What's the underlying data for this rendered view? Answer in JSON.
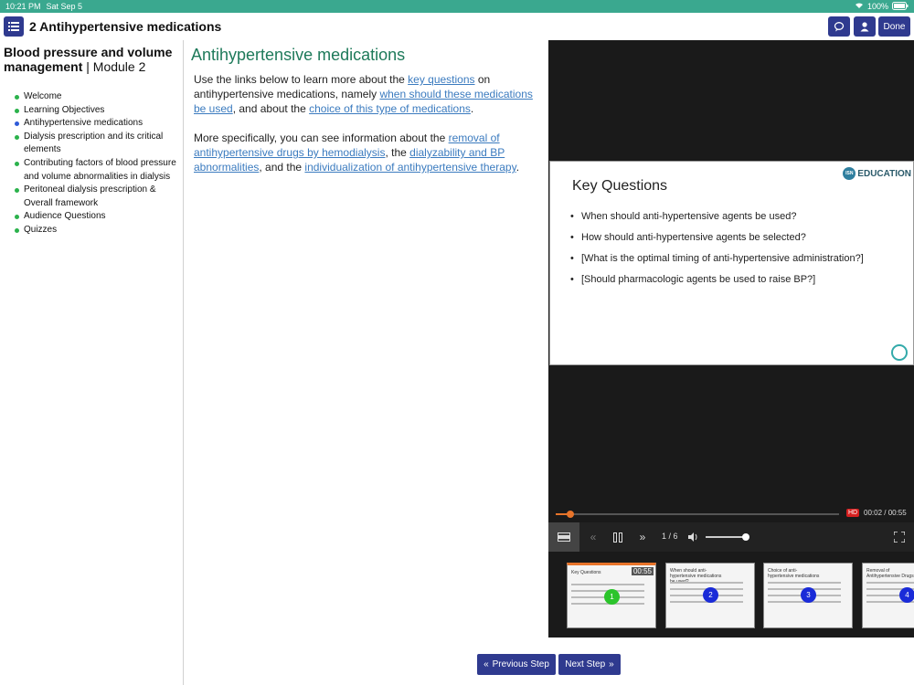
{
  "status": {
    "time": "10:21 PM",
    "date": "Sat Sep 5",
    "battery": "100%"
  },
  "header": {
    "title": "2 Antihypertensive medications",
    "done_label": "Done"
  },
  "sidebar": {
    "title_bold": "Blood pressure and volume management",
    "title_sep": " | ",
    "title_rest": "Module 2",
    "items": [
      {
        "label": "Welcome",
        "color": "#2bb24c"
      },
      {
        "label": "Learning Objectives",
        "color": "#2bb24c"
      },
      {
        "label": "Antihypertensive medications",
        "color": "#2f5bd8"
      },
      {
        "label": "Dialysis prescription and its critical elements",
        "color": "#2bb24c"
      },
      {
        "label": "Contributing factors of blood pressure and volume abnormalities in dialysis",
        "color": "#2bb24c"
      },
      {
        "label": "Peritoneal dialysis prescription & Overall framework",
        "color": "#2bb24c"
      },
      {
        "label": "Audience Questions",
        "color": "#2bb24c"
      },
      {
        "label": "Quizzes",
        "color": "#2bb24c"
      }
    ]
  },
  "main": {
    "heading": "Antihypertensive medications",
    "p1": {
      "t1": "Use the links below to learn more about the ",
      "l1": "key questions",
      "t2": " on antihypertensive medications, namely ",
      "l2": "when should these medications be used",
      "t3": ", and about the ",
      "l3": "choice of this type of medications",
      "t4": "."
    },
    "p2": {
      "t1": "More specifically, you can see information about the ",
      "l1": "removal of antihypertensive drugs by hemodialysis",
      "t2": ", the ",
      "l2": "dialyzability and BP abnormalities",
      "t3": ", and the ",
      "l3": "individualization of antihypertensive therapy",
      "t4": "."
    }
  },
  "video": {
    "slide_title": "Key Questions",
    "logo_text": "EDUCATION",
    "logo_small": "ISN",
    "bullets": [
      "When should anti-hypertensive agents be used?",
      "How should anti-hypertensive agents be selected?",
      "[What is the optimal timing of anti-hypertensive administration?]",
      "[Should pharmacologic agents be used to raise BP?]"
    ],
    "hd": "HD",
    "time": "00:02 / 00:55",
    "progress": 0.05,
    "volume": 1.0,
    "page": "1 / 6",
    "thumbs": [
      {
        "title": "Key Questions",
        "num": "1",
        "dur": "00:55"
      },
      {
        "title": "When should anti-hypertensive medications be used?",
        "num": "2"
      },
      {
        "title": "Choice of anti-hypertensive medications",
        "num": "3"
      },
      {
        "title": "Removal of Antihypertensive Drugs",
        "num": "4"
      }
    ]
  },
  "nav": {
    "prev": "Previous Step",
    "next": "Next Step"
  }
}
